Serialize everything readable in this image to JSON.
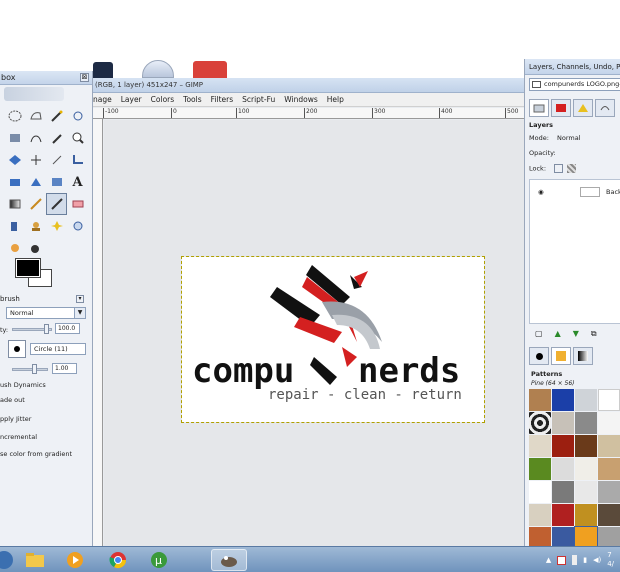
{
  "toolbox": {
    "title": "box",
    "close": "⊠",
    "brush_section": "brush",
    "mode_value": "Normal",
    "opacity_label": "ty:",
    "opacity_value": "100.0",
    "brush_name": "Circle (11)",
    "scale_value": "1.00",
    "dynamics_label": "ush Dynamics",
    "fade_out": "ade out",
    "apply_jitter": "pply Jitter",
    "incremental": "ncremental",
    "use_color_gradient": "se color from gradient"
  },
  "image_window": {
    "title": "(RGB, 1 layer) 451x247 – GIMP",
    "menu": [
      "nage",
      "Layer",
      "Colors",
      "Tools",
      "Filters",
      "Script-Fu",
      "Windows",
      "Help"
    ],
    "ruler_labels": [
      "-100",
      "0",
      "100",
      "200",
      "300",
      "400",
      "500"
    ],
    "logo": {
      "word1": "compu",
      "word2": "nerds",
      "tagline": "repair - clean - return"
    }
  },
  "dock": {
    "title": "Layers, Channels, Undo, P",
    "image_selector": "compunerds LOGO.png-",
    "layers_heading": "Layers",
    "mode_label": "Mode:",
    "mode_value": "Normal",
    "opacity_label": "Opacity:",
    "lock_label": "Lock:",
    "layer_name": "Backg",
    "patterns_heading": "Patterns",
    "pattern_name": "Pine (64 × 56)"
  },
  "taskbar": {
    "clock_time": "7",
    "clock_date": "4/"
  },
  "colors": {
    "accent_red": "#d42020",
    "logo_black": "#111111",
    "tagline_gray": "#555555"
  }
}
